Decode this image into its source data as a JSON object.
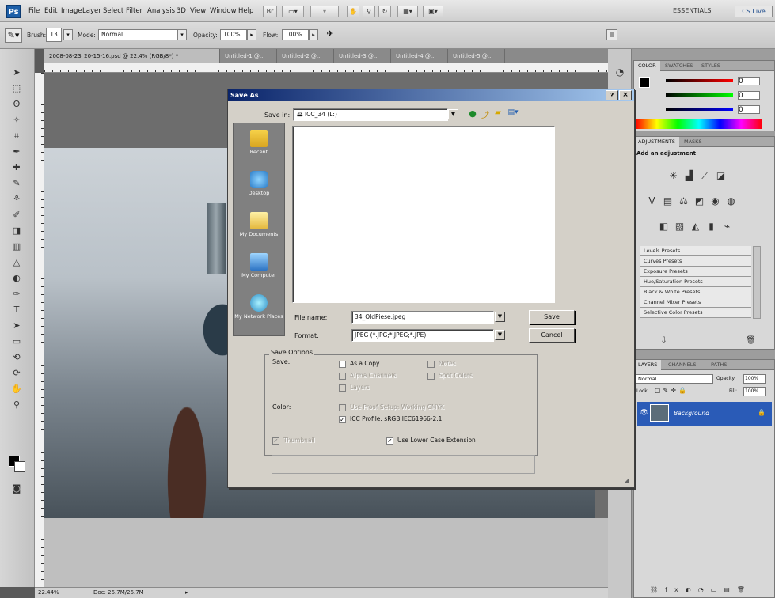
{
  "menubar": {
    "items": [
      "File",
      "Edit",
      "Image",
      "Layer",
      "Select",
      "Filter",
      "Analysis",
      "3D",
      "View",
      "Window",
      "Help"
    ],
    "workspace": "ESSENTIALS",
    "cs_live": "CS Live"
  },
  "options_bar": {
    "brush_label": "Brush:",
    "brush_size": "13",
    "mode_label": "Mode:",
    "mode_value": "Normal",
    "opacity_label": "Opacity:",
    "opacity_value": "100%",
    "flow_label": "Flow:",
    "flow_value": "100%"
  },
  "doc_tabs": [
    "2008-08-23_20-15-16.psd @ 22.4% (RGB/8*) *",
    "Untitled-1 @...",
    "Untitled-2 @...",
    "Untitled-3 @...",
    "Untitled-4 @...",
    "Untitled-5 @..."
  ],
  "status": {
    "zoom": "22.44%",
    "doc": "Doc: 26.7M/26.7M"
  },
  "panels": {
    "color_tabs": [
      "COLOR",
      "SWATCHES",
      "STYLES"
    ],
    "color_values": [
      "0",
      "0",
      "0"
    ],
    "adj_tabs": [
      "ADJUSTMENTS",
      "MASKS"
    ],
    "adj_title": "Add an adjustment",
    "presets": [
      "Levels Presets",
      "Curves Presets",
      "Exposure Presets",
      "Hue/Saturation Presets",
      "Black & White Presets",
      "Channel Mixer Presets",
      "Selective Color Presets"
    ],
    "layers_tabs": [
      "LAYERS",
      "CHANNELS",
      "PATHS"
    ],
    "blend_mode": "Normal",
    "opacity_label": "Opacity:",
    "opacity_value": "100%",
    "lock_label": "Lock:",
    "fill_label": "Fill:",
    "fill_value": "100%",
    "layer_name": "Background"
  },
  "dialog": {
    "title": "Save As",
    "save_in_label": "Save in:",
    "save_in_value": "ICC_34 (L:)",
    "places": [
      "Recent",
      "Desktop",
      "My Documents",
      "My Computer",
      "My Network Places"
    ],
    "filename_label": "File name:",
    "filename_value": "34_OldPiese.jpeg",
    "format_label": "Format:",
    "format_value": "JPEG (*.JPG;*.JPEG;*.JPE)",
    "save_button": "Save",
    "cancel_button": "Cancel",
    "save_options_label": "Save Options",
    "save_label": "Save:",
    "as_copy": "As a Copy",
    "notes": "Notes",
    "alpha_channels": "Alpha Channels",
    "spot_colors": "Spot Colors",
    "layers": "Layers",
    "color_label": "Color:",
    "use_proof": "Use Proof Setup: Working CMYK",
    "icc_profile": "ICC Profile: sRGB IEC61966-2.1",
    "thumbnail": "Thumbnail",
    "lowercase_ext": "Use Lower Case Extension"
  }
}
